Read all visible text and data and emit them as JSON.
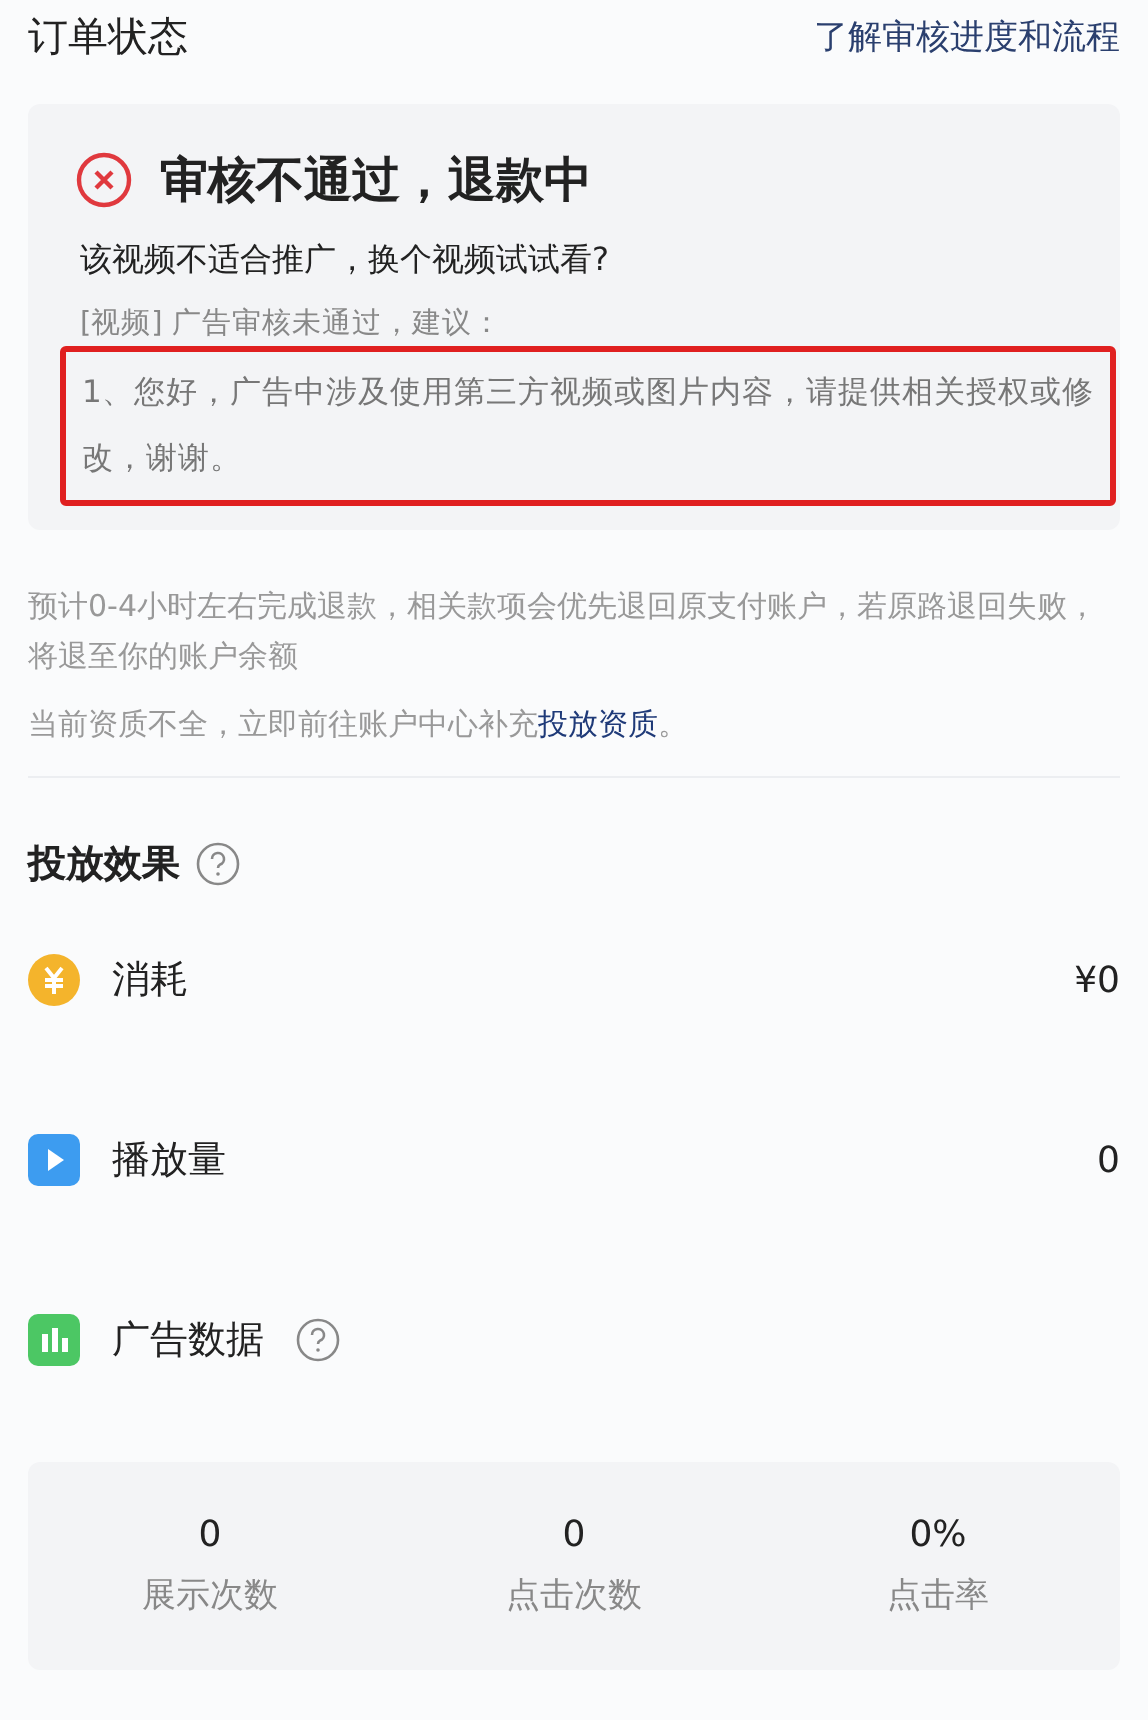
{
  "header": {
    "title": "订单状态",
    "link": "了解审核进度和流程"
  },
  "review": {
    "status": "审核不通过，退款中",
    "subtitle": "该视频不适合推广，换个视频试试看?",
    "reason_label": "[视频] 广告审核未通过，建议：",
    "reason": "1、您好，广告中涉及使用第三方视频或图片内容，请提供相关授权或修改，谢谢。",
    "highlighted": true
  },
  "refund_note": "预计0-4小时左右完成退款，相关款项会优先退回原支付账户，若原路退回失败，将退至你的账户余额",
  "qualification": {
    "text": "当前资质不全，立即前往账户中心补充",
    "link": "投放资质",
    "end": "。"
  },
  "effect": {
    "title": "投放效果",
    "metrics": [
      {
        "kind": "cost",
        "label": "消耗",
        "value": "¥0"
      },
      {
        "kind": "plays",
        "label": "播放量",
        "value": "0"
      },
      {
        "kind": "data",
        "label": "广告数据",
        "help": true
      }
    ],
    "stats": [
      {
        "value": "0",
        "label": "展示次数"
      },
      {
        "value": "0",
        "label": "点击次数"
      },
      {
        "value": "0%",
        "label": "点击率"
      }
    ]
  }
}
